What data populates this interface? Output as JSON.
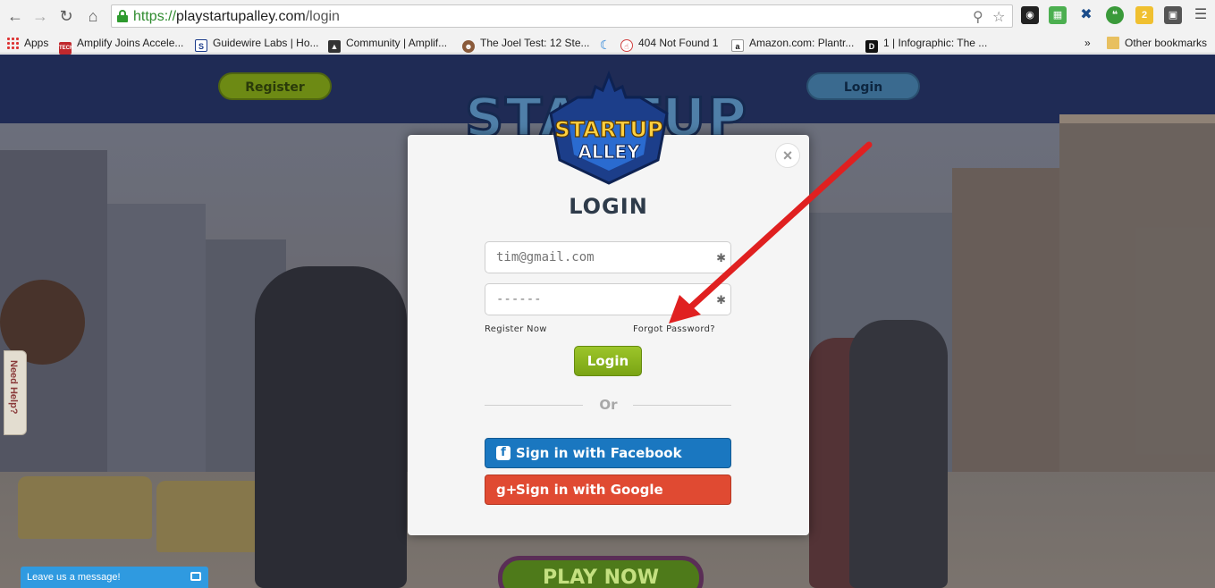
{
  "browser": {
    "url_scheme": "https://",
    "url_host": "playstartupalley.com",
    "url_path": "/login",
    "bookmarks": [
      {
        "label": "Apps"
      },
      {
        "label": "Amplify Joins Accele..."
      },
      {
        "label": "Guidewire Labs | Ho..."
      },
      {
        "label": "Community | Amplif..."
      },
      {
        "label": "The Joel Test: 12 Ste..."
      },
      {
        "label": ""
      },
      {
        "label": "404 Not Found 1"
      },
      {
        "label": "Amazon.com: Plantr..."
      },
      {
        "label": "1 | Infographic: The ..."
      }
    ],
    "overflow_label": "»",
    "other_bookmarks": "Other bookmarks",
    "ext_badge": "2"
  },
  "header": {
    "register_label": "Register",
    "login_label": "Login",
    "logo_text": "STARTUP"
  },
  "modal": {
    "logo_top": "STARTUP",
    "logo_bottom": "ALLEY",
    "close_label": "×",
    "title": "LOGIN",
    "email_placeholder": "tim@gmail.com",
    "password_value": "------",
    "register_now": "Register Now",
    "forgot_password": "Forgot Password?",
    "login_button": "Login",
    "or_text": "Or",
    "facebook_label": "Sign in with Facebook",
    "google_label": "Sign in with Google",
    "facebook_icon": "f",
    "google_icon": "g+"
  },
  "page": {
    "help_tab": "Need Help?",
    "chat_label": "Leave us a message!",
    "play_now": "PLAY NOW"
  },
  "colors": {
    "accent_red": "#e02020",
    "facebook": "#1a77c0",
    "google": "#e04a32",
    "login_green": "#8bb81f"
  }
}
